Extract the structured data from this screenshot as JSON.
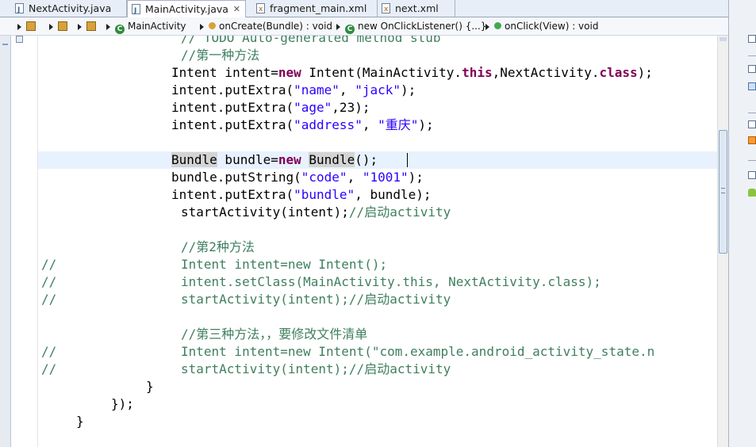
{
  "tabs": [
    {
      "label": "NextActivity.java",
      "active": false,
      "icon": "java-file-icon"
    },
    {
      "label": "MainActivity.java",
      "active": true,
      "icon": "java-file-icon"
    },
    {
      "label": "fragment_main.xml",
      "active": false,
      "icon": "xml-file-icon"
    },
    {
      "label": "next.xml",
      "active": false,
      "icon": "xml-file-icon"
    }
  ],
  "breadcrumb": {
    "class": "MainActivity",
    "method1": "onCreate(Bundle) : void",
    "inner": "new OnClickListener() {...}",
    "method2": "onClick(View) : void"
  },
  "code": {
    "l0": "// TODO Auto-generated method stub",
    "l1": "//第一种方法",
    "l2_a": "Intent intent=",
    "l2_kw": "new",
    "l2_b": " Intent(MainActivity.",
    "l2_kw2": "this",
    "l2_c": ",NextActivity.",
    "l2_kw3": "class",
    "l2_d": ");",
    "l3_a": "intent.putExtra(",
    "l3_s1": "\"name\"",
    "l3_b": ", ",
    "l3_s2": "\"jack\"",
    "l3_c": ");",
    "l4_a": "intent.putExtra(",
    "l4_s1": "\"age\"",
    "l4_b": ",23);",
    "l5_a": "intent.putExtra(",
    "l5_s1": "\"address\"",
    "l5_b": ", ",
    "l5_s2": "\"重庆\"",
    "l5_c": ");",
    "l7_hl1": "Bundle",
    "l7_a": " bundle=",
    "l7_kw": "new",
    "l7_b": " ",
    "l7_hl2": "Bundle",
    "l7_c": "();",
    "l8_a": "bundle.putString(",
    "l8_s1": "\"code\"",
    "l8_b": ", ",
    "l8_s2": "\"1001\"",
    "l8_c": ");",
    "l9_a": "intent.putExtra(",
    "l9_s1": "\"bundle\"",
    "l9_b": ", bundle);",
    "l10_a": "startActivity(intent);",
    "l10_cm": "//启动activity",
    "l12": "//第2种方法",
    "l13_pre": "//",
    "l13": "Intent intent=new Intent();",
    "l14_pre": "//",
    "l14": "intent.setClass(MainActivity.this, NextActivity.class);",
    "l15_pre": "//",
    "l15": "startActivity(intent);//启动activity",
    "l17": "//第三种方法，，要修改文件清单",
    "l18_pre": "//",
    "l18": "Intent intent=new Intent(\"com.example.android_activity_state.n",
    "l19_pre": "//",
    "l19": "startActivity(intent);//启动activity",
    "l20": "}",
    "l21": "});",
    "l22": "}"
  }
}
